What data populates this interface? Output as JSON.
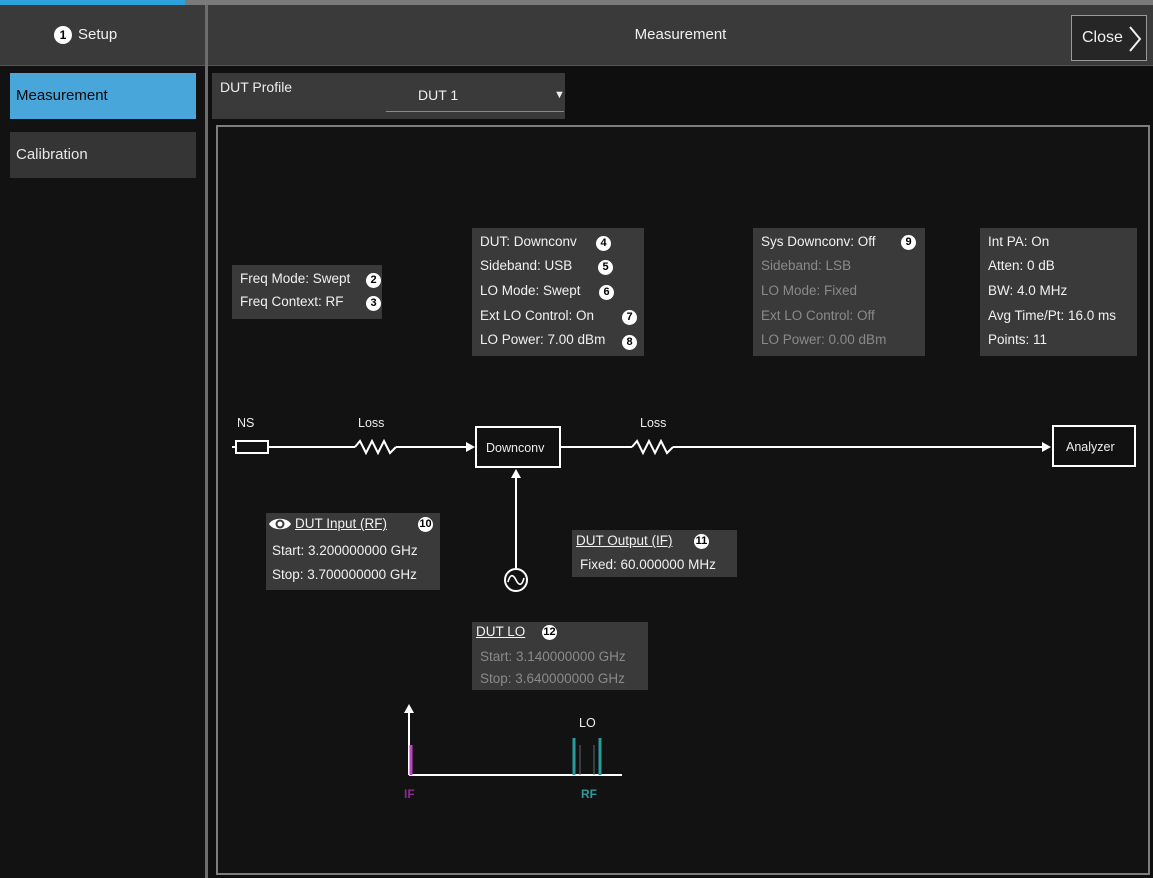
{
  "sidebar": {
    "header_badge": "1",
    "header_label": "Setup",
    "items": [
      {
        "label": "Measurement",
        "active": true
      },
      {
        "label": "Calibration",
        "active": false
      }
    ]
  },
  "header": {
    "title": "Measurement",
    "close_label": "Close"
  },
  "dut_profile": {
    "label": "DUT Profile",
    "selected": "DUT 1"
  },
  "freq_box": {
    "lines": [
      {
        "text": "Freq Mode: Swept",
        "badge": "2"
      },
      {
        "text": "Freq Context: RF",
        "badge": "3"
      }
    ]
  },
  "dut_box": {
    "lines": [
      {
        "text": "DUT: Downconv",
        "badge": "4"
      },
      {
        "text": "Sideband: USB",
        "badge": "5"
      },
      {
        "text": "LO Mode: Swept",
        "badge": "6"
      },
      {
        "text": "Ext LO Control: On",
        "badge": "7"
      },
      {
        "text": "LO Power: 7.00 dBm",
        "badge": "8"
      }
    ]
  },
  "sys_box": {
    "title": "Sys Downconv: Off",
    "badge": "9",
    "lines": [
      "Sideband: LSB",
      "LO Mode: Fixed",
      "Ext LO Control: Off",
      "LO Power: 0.00 dBm"
    ]
  },
  "analyzer_box": {
    "lines": [
      "Int PA: On",
      "Atten: 0 dB",
      "BW: 4.0 MHz",
      "Avg Time/Pt: 16.0 ms",
      "Points: 11"
    ]
  },
  "diagram": {
    "ns_label": "NS",
    "loss1_label": "Loss",
    "loss2_label": "Loss",
    "downconv_label": "Downconv",
    "analyzer_label": "Analyzer"
  },
  "dut_input": {
    "title": "DUT Input (RF)",
    "badge": "10",
    "start": "Start: 3.200000000 GHz",
    "stop": "Stop: 3.700000000 GHz"
  },
  "dut_output": {
    "title": "DUT Output (IF)",
    "badge": "11",
    "fixed": "Fixed: 60.000000 MHz"
  },
  "dut_lo": {
    "title": "DUT LO",
    "badge": "12",
    "start": "Start: 3.140000000 GHz",
    "stop": "Stop: 3.640000000 GHz"
  },
  "spectrum": {
    "lo_label": "LO",
    "if_label": "IF",
    "rf_label": "RF",
    "if_color": "#c040c8",
    "rf_color": "#2a9a9a"
  }
}
